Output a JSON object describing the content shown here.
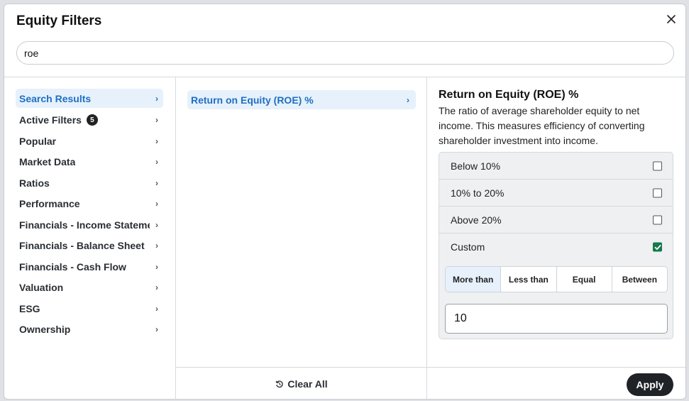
{
  "modal": {
    "title": "Equity Filters",
    "close_icon": "close-icon",
    "search": {
      "value": "roe",
      "placeholder": ""
    }
  },
  "sidebar": {
    "items": [
      {
        "label": "Search Results",
        "active": true
      },
      {
        "label": "Active Filters",
        "badge": "5"
      },
      {
        "label": "Popular"
      },
      {
        "label": "Market Data"
      },
      {
        "label": "Ratios"
      },
      {
        "label": "Performance"
      },
      {
        "label": "Financials - Income Statement"
      },
      {
        "label": "Financials - Balance Sheet"
      },
      {
        "label": "Financials - Cash Flow"
      },
      {
        "label": "Valuation"
      },
      {
        "label": "ESG"
      },
      {
        "label": "Ownership"
      }
    ]
  },
  "results": {
    "items": [
      {
        "label": "Return on Equity (ROE) %"
      }
    ],
    "clear_all_label": "Clear All",
    "clear_icon": "reset-icon"
  },
  "detail": {
    "title": "Return on Equity (ROE) %",
    "description": "The ratio of average shareholder equity to net income. This measures efficiency of converting shareholder investment into income.",
    "options": [
      {
        "label": "Below 10%",
        "checked": false
      },
      {
        "label": "10% to 20%",
        "checked": false
      },
      {
        "label": "Above 20%",
        "checked": false
      },
      {
        "label": "Custom",
        "checked": true
      }
    ],
    "operators": [
      {
        "label": "More than",
        "active": true
      },
      {
        "label": "Less than",
        "active": false
      },
      {
        "label": "Equal",
        "active": false
      },
      {
        "label": "Between",
        "active": false
      }
    ],
    "custom_value": "10",
    "apply_label": "Apply"
  },
  "colors": {
    "accent": "#1f6fc4",
    "accent_bg": "#e6f1fb",
    "checkbox_checked": "#137a4b",
    "apply_bg": "#1f2328"
  }
}
